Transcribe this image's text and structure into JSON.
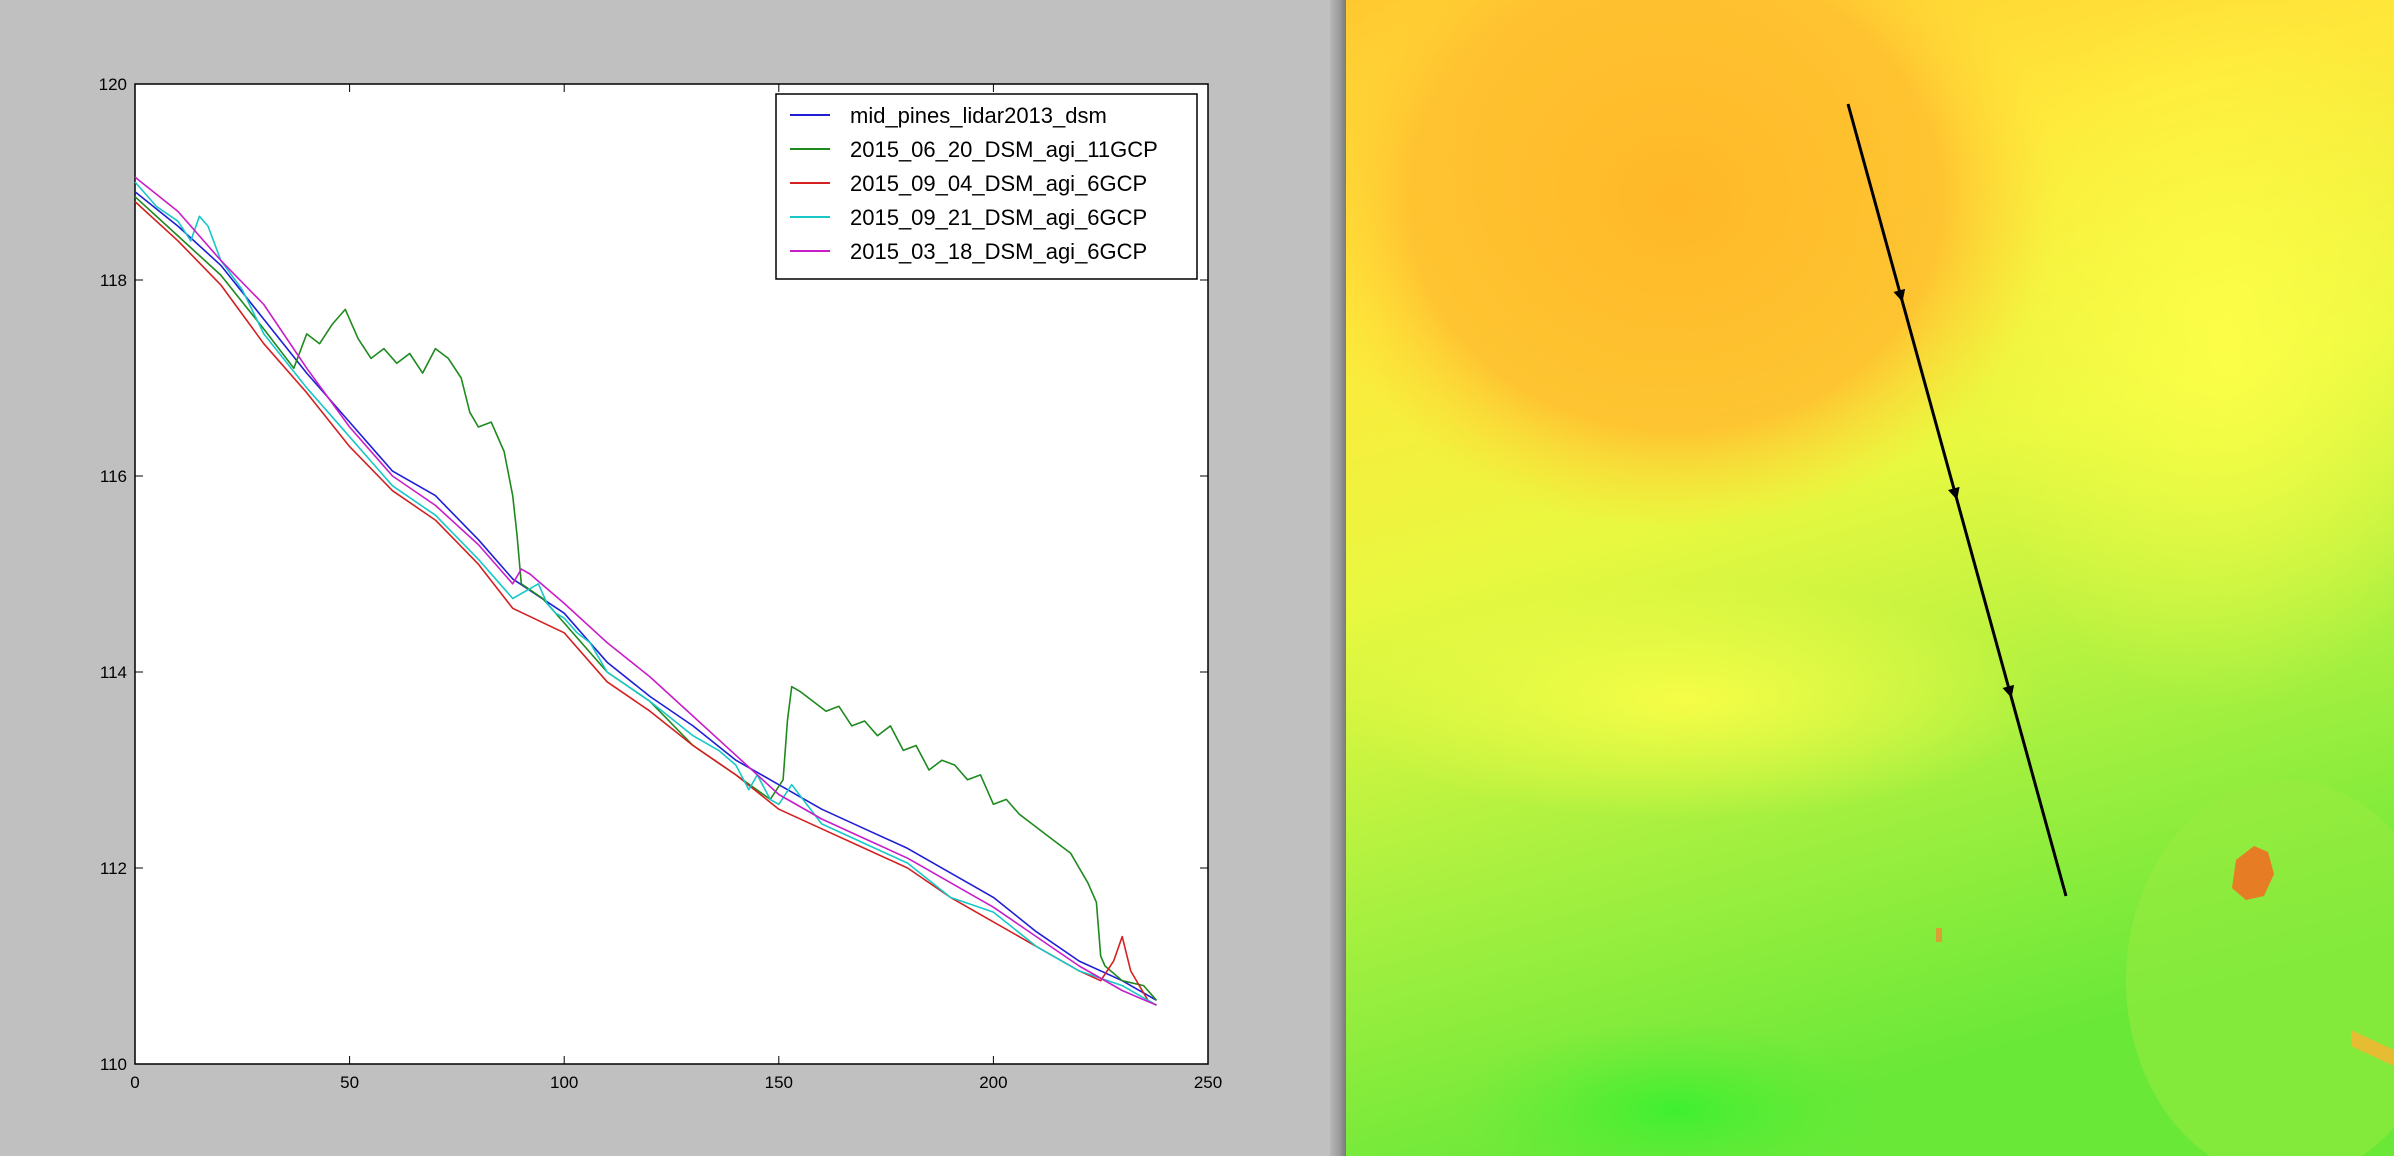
{
  "chart_data": {
    "type": "line",
    "title": "",
    "xlabel": "",
    "ylabel": "",
    "xlim": [
      0,
      250
    ],
    "ylim": [
      110,
      120
    ],
    "xticks": [
      0,
      50,
      100,
      150,
      200,
      250
    ],
    "yticks": [
      110,
      112,
      114,
      116,
      118,
      120
    ],
    "xtick_labels": [
      "0",
      "50",
      "100",
      "150",
      "200",
      "250"
    ],
    "ytick_labels": [
      "110",
      "112",
      "114",
      "116",
      "118",
      "120"
    ],
    "grid": false,
    "legend_position": "top-right",
    "series": [
      {
        "name": "mid_pines_lidar2013_dsm",
        "color": "#1f1fd6",
        "x": [
          0,
          10,
          20,
          30,
          40,
          50,
          60,
          70,
          80,
          88,
          100,
          110,
          120,
          130,
          140,
          150,
          160,
          170,
          180,
          190,
          200,
          210,
          220,
          230,
          238
        ],
        "y": [
          118.9,
          118.55,
          118.15,
          117.6,
          117.05,
          116.55,
          116.05,
          115.8,
          115.35,
          114.95,
          114.6,
          114.1,
          113.75,
          113.45,
          113.1,
          112.85,
          112.6,
          112.4,
          112.2,
          111.95,
          111.7,
          111.35,
          111.05,
          110.85,
          110.65
        ]
      },
      {
        "name": "2015_06_20_DSM_agi_11GCP",
        "color": "#1e8a1e",
        "x": [
          0,
          10,
          20,
          30,
          37,
          40,
          43,
          46,
          49,
          52,
          55,
          58,
          61,
          64,
          67,
          70,
          73,
          76,
          78,
          80,
          83,
          86,
          88,
          89,
          90,
          95,
          100,
          110,
          120,
          130,
          140,
          148,
          151,
          152,
          153,
          155,
          158,
          161,
          164,
          167,
          170,
          173,
          176,
          179,
          182,
          185,
          188,
          191,
          194,
          197,
          200,
          203,
          206,
          209,
          212,
          215,
          218,
          220,
          222,
          224,
          225,
          226,
          230,
          235,
          238
        ],
        "y": [
          118.85,
          118.45,
          118.05,
          117.5,
          117.1,
          117.45,
          117.35,
          117.55,
          117.7,
          117.4,
          117.2,
          117.3,
          117.15,
          117.25,
          117.05,
          117.3,
          117.2,
          117.0,
          116.65,
          116.5,
          116.55,
          116.25,
          115.8,
          115.4,
          114.9,
          114.75,
          114.5,
          114.0,
          113.7,
          113.25,
          112.95,
          112.7,
          112.9,
          113.5,
          113.85,
          113.8,
          113.7,
          113.6,
          113.65,
          113.45,
          113.5,
          113.35,
          113.45,
          113.2,
          113.25,
          113.0,
          113.1,
          113.05,
          112.9,
          112.95,
          112.65,
          112.7,
          112.55,
          112.45,
          112.35,
          112.25,
          112.15,
          112.0,
          111.85,
          111.65,
          111.1,
          111.0,
          110.85,
          110.8,
          110.65
        ]
      },
      {
        "name": "2015_09_04_DSM_agi_6GCP",
        "color": "#d42020",
        "x": [
          0,
          10,
          20,
          30,
          40,
          50,
          60,
          70,
          80,
          88,
          100,
          110,
          120,
          130,
          140,
          150,
          160,
          170,
          180,
          190,
          200,
          210,
          220,
          225,
          228,
          230,
          232,
          234,
          236,
          238
        ],
        "y": [
          118.8,
          118.4,
          117.95,
          117.35,
          116.85,
          116.3,
          115.85,
          115.55,
          115.1,
          114.65,
          114.4,
          113.9,
          113.6,
          113.25,
          112.95,
          112.6,
          112.4,
          112.2,
          112.0,
          111.7,
          111.45,
          111.2,
          110.95,
          110.85,
          111.05,
          111.3,
          110.95,
          110.8,
          110.65,
          110.6
        ]
      },
      {
        "name": "2015_09_21_DSM_agi_6GCP",
        "color": "#18c8c8",
        "x": [
          0,
          5,
          10,
          13,
          15,
          17,
          20,
          25,
          30,
          40,
          50,
          60,
          70,
          80,
          88,
          92,
          94,
          96,
          98,
          100,
          103,
          106,
          110,
          120,
          130,
          136,
          140,
          143,
          145,
          148,
          150,
          153,
          160,
          170,
          180,
          190,
          200,
          210,
          220,
          230,
          238
        ],
        "y": [
          119.0,
          118.75,
          118.6,
          118.4,
          118.65,
          118.55,
          118.2,
          117.9,
          117.45,
          116.9,
          116.4,
          115.9,
          115.6,
          115.15,
          114.75,
          114.85,
          114.9,
          114.7,
          114.6,
          114.55,
          114.4,
          114.3,
          114.0,
          113.7,
          113.35,
          113.2,
          113.05,
          112.8,
          112.95,
          112.7,
          112.65,
          112.85,
          112.45,
          112.25,
          112.05,
          111.7,
          111.55,
          111.2,
          110.95,
          110.8,
          110.6
        ]
      },
      {
        "name": "2015_03_18_DSM_agi_6GCP",
        "color": "#c81ec8",
        "x": [
          0,
          10,
          20,
          30,
          40,
          50,
          60,
          70,
          80,
          88,
          90,
          92,
          100,
          110,
          120,
          130,
          140,
          150,
          160,
          170,
          180,
          190,
          200,
          210,
          220,
          230,
          238
        ],
        "y": [
          119.05,
          118.7,
          118.2,
          117.75,
          117.1,
          116.5,
          116.0,
          115.7,
          115.3,
          114.9,
          115.05,
          115.0,
          114.7,
          114.3,
          113.95,
          113.55,
          113.15,
          112.75,
          112.5,
          112.3,
          112.1,
          111.85,
          111.6,
          111.3,
          111.0,
          110.75,
          110.6
        ]
      }
    ]
  },
  "map": {
    "path_arrow_count": 3
  }
}
